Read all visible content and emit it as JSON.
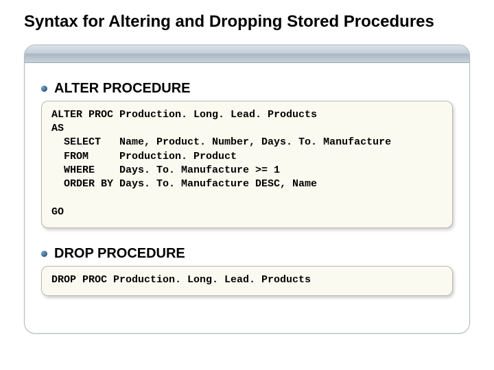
{
  "title": "Syntax for Altering and Dropping Stored Procedures",
  "sections": [
    {
      "label": "ALTER PROCEDURE",
      "code": "ALTER PROC Production. Long. Lead. Products\nAS\n  SELECT   Name, Product. Number, Days. To. Manufacture\n  FROM     Production. Product\n  WHERE    Days. To. Manufacture >= 1\n  ORDER BY Days. To. Manufacture DESC, Name\n\nGO"
    },
    {
      "label": "DROP PROCEDURE",
      "code": "DROP PROC Production. Long. Lead. Products"
    }
  ]
}
